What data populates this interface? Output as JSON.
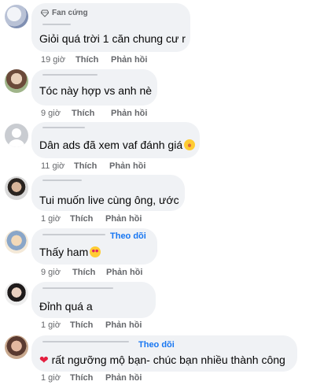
{
  "comments": [
    {
      "badge": "Fan cứng",
      "text": "Giỏi quá trời 1 căn chung cư r",
      "time": "19 giờ",
      "like": "Thích",
      "reply": "Phản hồi"
    },
    {
      "text": "Tóc này hợp vs anh nè",
      "time": "9 giờ",
      "like": "Thích",
      "reply": "Phản hồi"
    },
    {
      "text": "Dân ads đã xem vaf đánh giá",
      "emoji": "rolling-laughing-emoji",
      "time": "11 giờ",
      "like": "Thích",
      "reply": "Phản hồi"
    },
    {
      "text": "Tui muốn live cùng ông, ước",
      "time": "1 giờ",
      "like": "Thích",
      "reply": "Phản hồi"
    },
    {
      "follow": "Theo dõi",
      "text": "Thấy ham",
      "emoji": "heart-eyes-emoji",
      "time": "9 giờ",
      "like": "Thích",
      "reply": "Phản hồi"
    },
    {
      "text": "Đỉnh quá a",
      "time": "1 giờ",
      "like": "Thích",
      "reply": "Phản hồi"
    },
    {
      "follow": "Theo dõi",
      "emoji_prefix": "red-heart-emoji",
      "text": "rất ngưỡng mộ bạn- chúc bạn nhiều thành công",
      "time": "1 giờ",
      "like": "Thích",
      "reply": "Phản hồi"
    }
  ],
  "colors": {
    "bubble": "#f0f2f5",
    "meta": "#65676b",
    "link": "#1877f2"
  }
}
